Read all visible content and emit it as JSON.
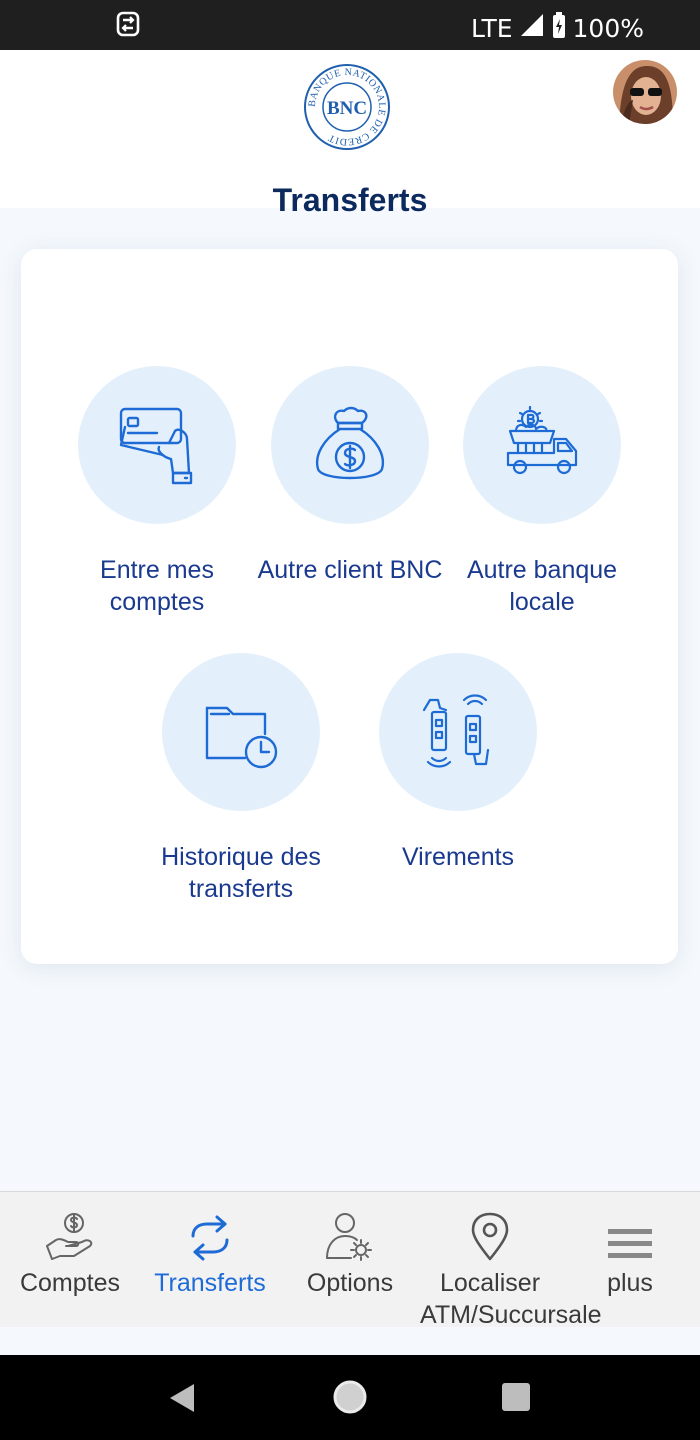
{
  "status_bar": {
    "network": "LTE",
    "battery": "100%"
  },
  "header": {
    "logo_text": "BNC",
    "logo_ring_text": "BANQUE NATIONALE DE CREDIT",
    "page_title": "Transferts"
  },
  "tiles": [
    {
      "label": "Entre mes comptes",
      "icon": "card-hand-icon"
    },
    {
      "label": "Autre client BNC",
      "icon": "money-bag-icon"
    },
    {
      "label": "Autre banque locale",
      "icon": "truck-icon"
    },
    {
      "label": "Historique des transferts",
      "icon": "folder-clock-icon"
    },
    {
      "label": "Virements",
      "icon": "phone-transfer-icon"
    }
  ],
  "bottom_nav": [
    {
      "label": "Comptes",
      "icon": "hand-coin-icon"
    },
    {
      "label": "Transferts",
      "icon": "transfer-arrows-icon",
      "active": true
    },
    {
      "label": "Options",
      "icon": "user-gear-icon"
    },
    {
      "label": "Localiser ATM/Succursale",
      "icon": "location-pin-icon"
    },
    {
      "label": "plus",
      "icon": "menu-icon"
    }
  ],
  "colors": {
    "accent": "#1e6bd6",
    "title": "#0d2a5e",
    "tile_text": "#1a3a8f",
    "tile_circle": "#e3f0fb"
  }
}
